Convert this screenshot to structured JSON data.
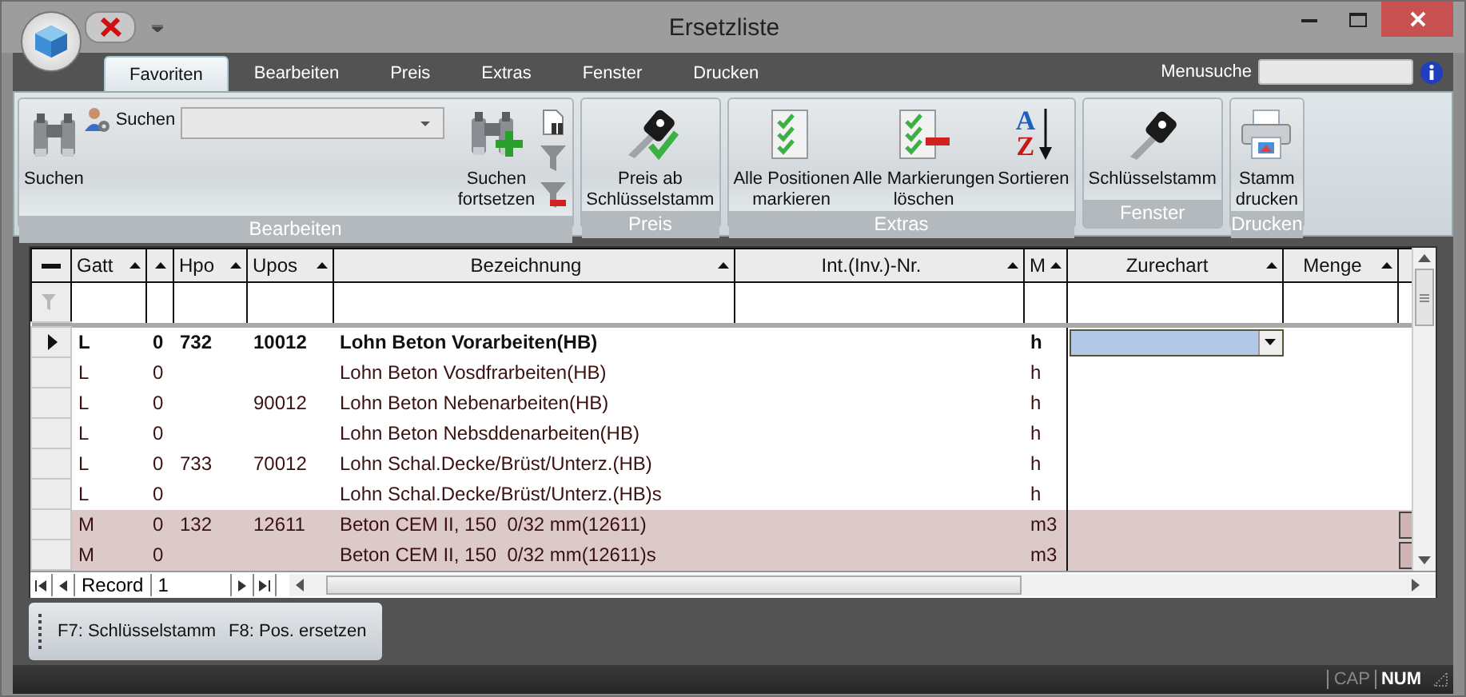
{
  "window": {
    "title": "Ersetzliste"
  },
  "tabs": [
    {
      "label": "Favoriten",
      "selected": true
    },
    {
      "label": "Bearbeiten",
      "selected": false
    },
    {
      "label": "Preis",
      "selected": false
    },
    {
      "label": "Extras",
      "selected": false
    },
    {
      "label": "Fenster",
      "selected": false
    },
    {
      "label": "Drucken",
      "selected": false
    }
  ],
  "menu_search": {
    "label": "Menusuche"
  },
  "ribbon_groups": [
    {
      "caption": "Bearbeiten",
      "items": [
        {
          "kind": "find",
          "label": "Suchen"
        },
        {
          "kind": "combo",
          "label": "Suchen"
        },
        {
          "kind": "findnext",
          "label": "Suchen\nfortsetzen"
        },
        {
          "kind": "tools"
        }
      ]
    },
    {
      "caption": "Preis",
      "items": [
        {
          "kind": "keyprice",
          "label": "Preis ab\nSchlüsselstamm"
        }
      ]
    },
    {
      "caption": "Extras",
      "items": [
        {
          "kind": "markall",
          "label": "Alle Positionen\nmarkieren"
        },
        {
          "kind": "unmark",
          "label": "Alle Markierungen\nlöschen"
        },
        {
          "kind": "sort",
          "label": "Sortieren",
          "glyphs": [
            "A",
            "Z"
          ]
        }
      ]
    },
    {
      "caption": "Fenster",
      "items": [
        {
          "kind": "key",
          "label": "Schlüsselstamm"
        }
      ]
    },
    {
      "caption": "Drucken",
      "items": [
        {
          "kind": "print",
          "label": "Stamm\ndrucken"
        }
      ]
    }
  ],
  "table": {
    "columns": [
      {
        "label": "Gatt",
        "sortable": true
      },
      {
        "sortable": true
      },
      {
        "label": "Hpo",
        "sortable": true
      },
      {
        "label": "Upos",
        "sortable": true
      },
      {
        "label": "Bezeichnung",
        "sortable": true
      },
      {
        "label": "Int.(Inv.)-Nr.",
        "sortable": true
      },
      {
        "label": "M",
        "sortable": true
      },
      {
        "label": "Zurechart",
        "sortable": true
      },
      {
        "label": "Menge",
        "sortable": true
      },
      {
        "sortable": false
      }
    ],
    "rows": [
      {
        "current": true,
        "highlighted": false,
        "cells": [
          "L",
          "0",
          "732",
          "10012",
          "Lohn Beton Vorarbeiten(HB)",
          null,
          "h",
          null,
          null,
          null
        ]
      },
      {
        "current": false,
        "highlighted": false,
        "cells": [
          "L",
          "0",
          null,
          null,
          "Lohn Beton Vosdfrarbeiten(HB)",
          null,
          "h",
          null,
          null,
          null
        ]
      },
      {
        "current": false,
        "highlighted": false,
        "cells": [
          "L",
          "0",
          null,
          "90012",
          "Lohn Beton Nebenarbeiten(HB)",
          null,
          "h",
          null,
          null,
          null
        ]
      },
      {
        "current": false,
        "highlighted": false,
        "cells": [
          "L",
          "0",
          null,
          null,
          "Lohn Beton Nebsddenarbeiten(HB)",
          null,
          "h",
          null,
          null,
          null
        ]
      },
      {
        "current": false,
        "highlighted": false,
        "cells": [
          "L",
          "0",
          "733",
          "70012",
          "Lohn Schal.Decke/Brüst/Unterz.(HB)",
          null,
          "h",
          null,
          null,
          null
        ]
      },
      {
        "current": false,
        "highlighted": false,
        "cells": [
          "L",
          "0",
          null,
          null,
          "Lohn Schal.Decke/Brüst/Unterz.(HB)s",
          null,
          "h",
          null,
          null,
          null
        ]
      },
      {
        "current": false,
        "highlighted": true,
        "cells": [
          "M",
          "0",
          "132",
          "12611",
          "Beton CEM II, 150  0/32 mm(12611)",
          null,
          "m3",
          null,
          null,
          null
        ]
      },
      {
        "current": false,
        "highlighted": true,
        "cells": [
          "M",
          "0",
          null,
          null,
          "Beton CEM II, 150  0/32 mm(12611)s",
          null,
          "m3",
          null,
          null,
          null
        ]
      }
    ],
    "navigator": {
      "label": "Record",
      "value": "1"
    }
  },
  "function_keys": [
    "F7: Schlüsselstamm",
    "F8: Pos. ersetzen"
  ],
  "status_bar": [
    {
      "label": "CAP",
      "on": false
    },
    {
      "label": "NUM",
      "on": true
    }
  ]
}
